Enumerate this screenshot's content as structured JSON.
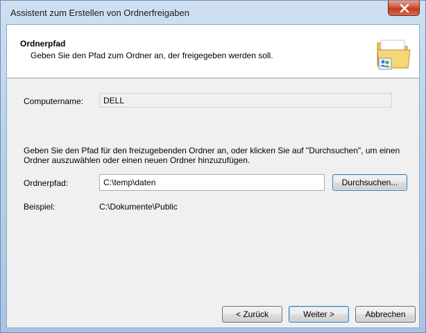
{
  "window": {
    "title": "Assistent zum Erstellen von Ordnerfreigaben"
  },
  "header": {
    "title": "Ordnerpfad",
    "subtitle": "Geben Sie den Pfad zum Ordner an, der freigegeben werden soll.",
    "icon": "shared-folder-icon"
  },
  "computer": {
    "label": "Computername:",
    "value": "DELL"
  },
  "instructions": "Geben Sie den Pfad für den freizugebenden Ordner an, oder klicken Sie auf \"Durchsuchen\", um einen Ordner auszuwählen oder einen neuen Ordner hinzuzufügen.",
  "path": {
    "label": "Ordnerpfad:",
    "value": "C:\\temp\\daten",
    "browse_label": "Durchsuchen..."
  },
  "example": {
    "label": "Beispiel:",
    "value": "C:\\Dokumente\\Public"
  },
  "footer": {
    "back_label": "< Zurück",
    "next_label": "Weiter >",
    "cancel_label": "Abbrechen"
  },
  "colors": {
    "close_button": "#c23b22",
    "title_bar": "#b9d1ea",
    "dialog_background": "#f0f0f0"
  }
}
